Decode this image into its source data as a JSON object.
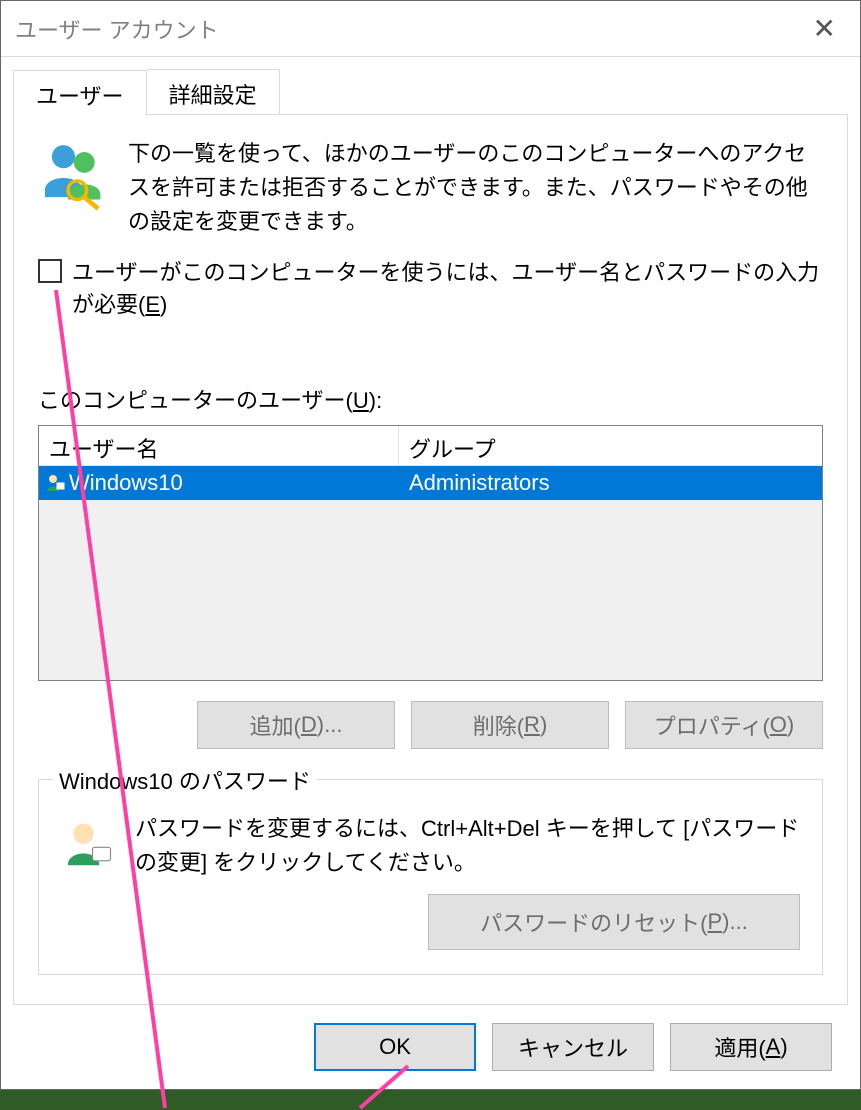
{
  "window": {
    "title": "ユーザー アカウント"
  },
  "tabs": {
    "users": "ユーザー",
    "advanced": "詳細設定"
  },
  "intro": "下の一覧を使って、ほかのユーザーのこのコンピューターへのアクセスを許可または拒否することができます。また、パスワードやその他の設定を変更できます。",
  "checkbox": {
    "label_pre": "ユーザーがこのコンピューターを使うには、ユーザー名とパスワードの入力が必要(",
    "mnemonic": "E",
    "label_post": ")"
  },
  "list": {
    "label_pre": "このコンピューターのユーザー(",
    "label_mnemonic": "U",
    "label_post": "):",
    "col_user": "ユーザー名",
    "col_group": "グループ",
    "rows": [
      {
        "user": "Windows10",
        "group": "Administrators"
      }
    ]
  },
  "buttons": {
    "add_pre": "追加(",
    "add_m": "D",
    "add_post": ")...",
    "remove_pre": "削除(",
    "remove_m": "R",
    "remove_post": ")",
    "props_pre": "プロパティ(",
    "props_m": "O",
    "props_post": ")"
  },
  "password_group": {
    "title": "Windows10 のパスワード",
    "text": "パスワードを変更するには、Ctrl+Alt+Del キーを押して [パスワードの変更] をクリックしてください。",
    "reset_pre": "パスワードのリセット(",
    "reset_m": "P",
    "reset_post": ")..."
  },
  "dialog_buttons": {
    "ok": "OK",
    "cancel": "キャンセル",
    "apply_pre": "適用(",
    "apply_m": "A",
    "apply_post": ")"
  }
}
